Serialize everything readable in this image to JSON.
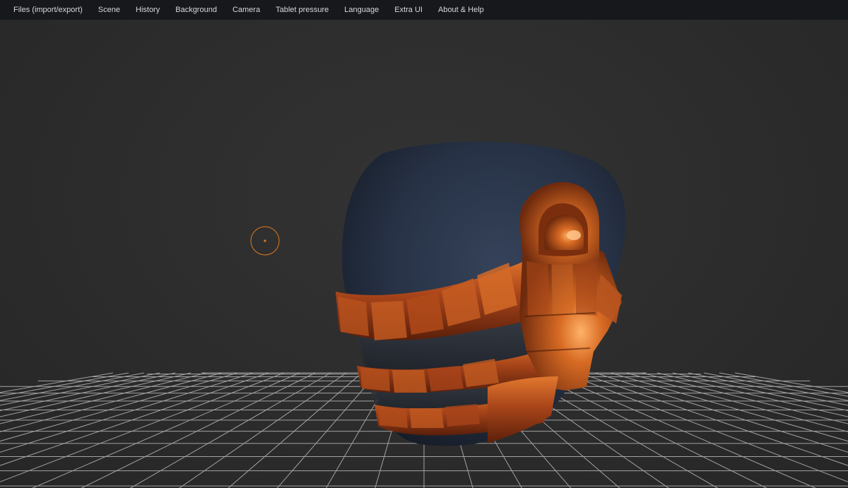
{
  "menubar": {
    "items": [
      {
        "label": "Files (import/export)",
        "name": "menu-files"
      },
      {
        "label": "Scene",
        "name": "menu-scene"
      },
      {
        "label": "History",
        "name": "menu-history"
      },
      {
        "label": "Background",
        "name": "menu-background"
      },
      {
        "label": "Camera",
        "name": "menu-camera"
      },
      {
        "label": "Tablet pressure",
        "name": "menu-tablet-pressure"
      },
      {
        "label": "Language",
        "name": "menu-language"
      },
      {
        "label": "Extra UI",
        "name": "menu-extra-ui"
      },
      {
        "label": "About & Help",
        "name": "menu-about-help"
      }
    ]
  },
  "colors": {
    "menubar_bg": "#16181c",
    "viewport_bg": "#2c2c2c",
    "mesh_base": "#2a3446",
    "mesh_accent": "#c85a1e",
    "brush_cursor": "#e07a1f",
    "grid": "#bdbdbd"
  }
}
